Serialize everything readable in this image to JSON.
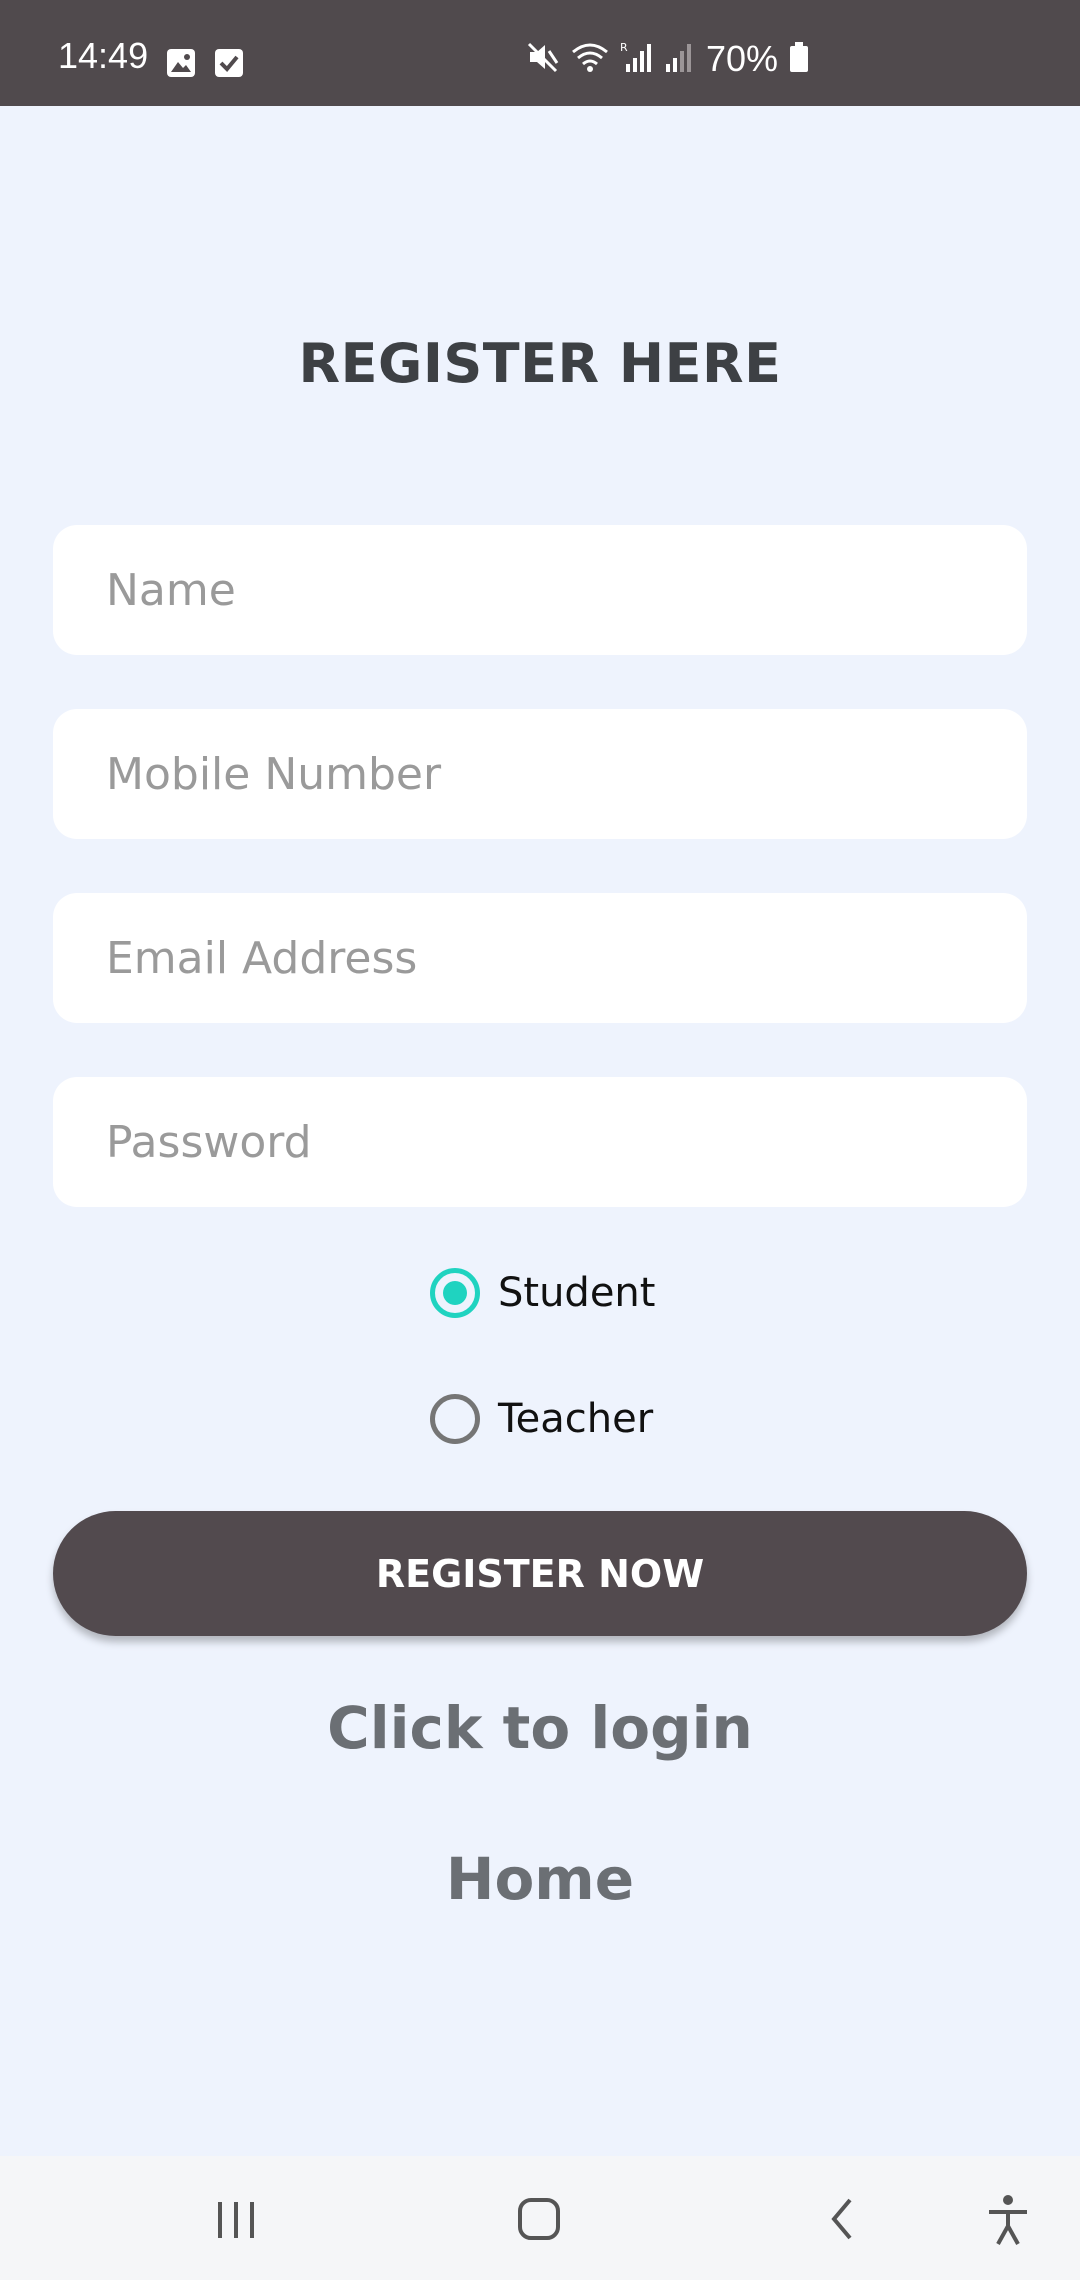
{
  "status_bar": {
    "time": "14:49",
    "battery": "70%",
    "icons": [
      "image-icon",
      "check-box-icon",
      "mute-icon",
      "wifi-icon",
      "signal-roaming-icon",
      "signal-icon",
      "battery-icon"
    ]
  },
  "page": {
    "title": "REGISTER HERE"
  },
  "form": {
    "name_placeholder": "Name",
    "mobile_placeholder": "Mobile Number",
    "email_placeholder": "Email Address",
    "password_placeholder": "Password",
    "roles": [
      {
        "label": "Student",
        "selected": true
      },
      {
        "label": "Teacher",
        "selected": false
      }
    ],
    "submit_label": "REGISTER NOW"
  },
  "links": {
    "login": "Click to login",
    "home": "Home"
  },
  "nav_bar": {
    "icons": [
      "recent-apps-icon",
      "home-icon",
      "back-icon",
      "accessibility-icon"
    ]
  },
  "colors": {
    "background": "#eef3fd",
    "status_bar": "#504a4d",
    "accent": "#1fd3c0",
    "button": "#524a4e",
    "link": "#6b6f74"
  }
}
